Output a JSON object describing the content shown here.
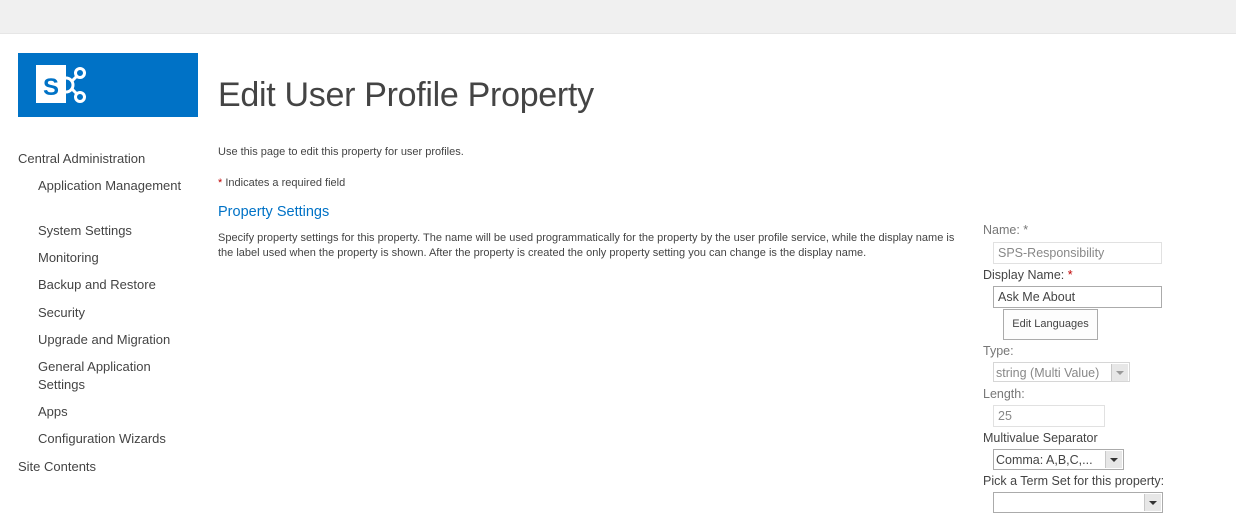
{
  "logo": {
    "letter": "S",
    "icon": "sharepoint-logo-icon"
  },
  "page": {
    "title": "Edit User Profile Property",
    "description": "Use this page to edit this property for user profiles.",
    "required_star": "*",
    "required_note": " Indicates a required field"
  },
  "quicklaunch": {
    "central_admin": "Central Administration",
    "items": [
      "Application Management",
      "System Settings",
      "Monitoring",
      "Backup and Restore",
      "Security",
      "Upgrade and Migration",
      "General Application Settings",
      "Apps",
      "Configuration Wizards"
    ],
    "site_contents": "Site Contents"
  },
  "section": {
    "title": "Property Settings",
    "description": "Specify property settings for this property. The name will be used programmatically for the property by the user profile service, while the display name is the label used when the property is shown. After the property is created the only property setting you can change is the display name."
  },
  "form": {
    "name_label": "Name: *",
    "name_value": "SPS-Responsibility",
    "display_name_label": "Display Name:",
    "display_name_star": " *",
    "display_name_value": "Ask Me About",
    "edit_languages": "Edit Languages",
    "type_label": "Type:",
    "type_value": "string (Multi Value)",
    "length_label": "Length:",
    "length_value": "25",
    "separator_label": "Multivalue Separator",
    "separator_value": "Comma: A,B,C,...",
    "termset_label": "Pick a Term Set for this property:",
    "termset_value": ""
  },
  "colors": {
    "brand": "#0072c6",
    "required": "#bf0000"
  }
}
